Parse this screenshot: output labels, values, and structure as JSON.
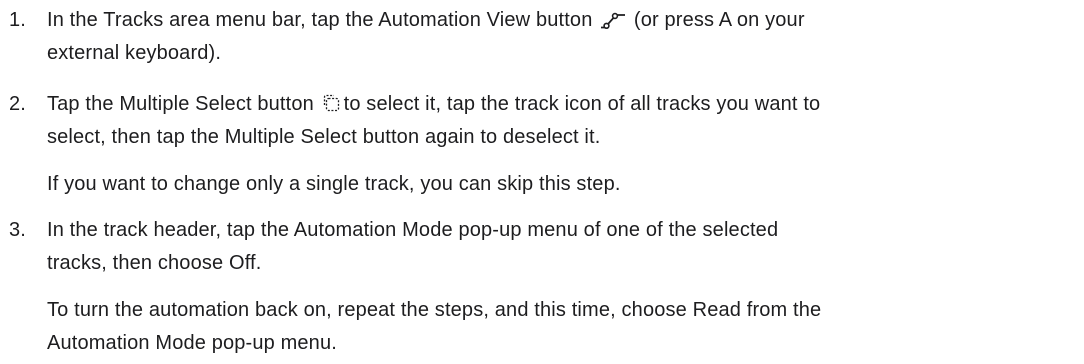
{
  "steps": [
    {
      "number": "1.",
      "text_before_icon": "In the Tracks area menu bar, tap the Automation View button",
      "icon": "automation-view-icon",
      "text_after_icon": "(or press A on your",
      "line2": "external keyboard)."
    },
    {
      "number": "2.",
      "text_before_icon": "Tap the Multiple Select button",
      "icon": "multiple-select-icon",
      "text_after_icon": "to select it, tap the track icon of all tracks you want to",
      "line2": "select, then tap the Multiple Select button again to deselect it.",
      "note": "If you want to change only a single track, you can skip this step."
    },
    {
      "number": "3.",
      "line1": "In the track header, tap the Automation Mode pop-up menu of one of the selected",
      "line2": "tracks, then choose Off.",
      "note_line1": "To turn the automation back on, repeat the steps, and this time, choose Read from the",
      "note_line2": "Automation Mode pop-up menu."
    }
  ],
  "colors": {
    "text": "#1d1d1f",
    "background": "#ffffff"
  }
}
